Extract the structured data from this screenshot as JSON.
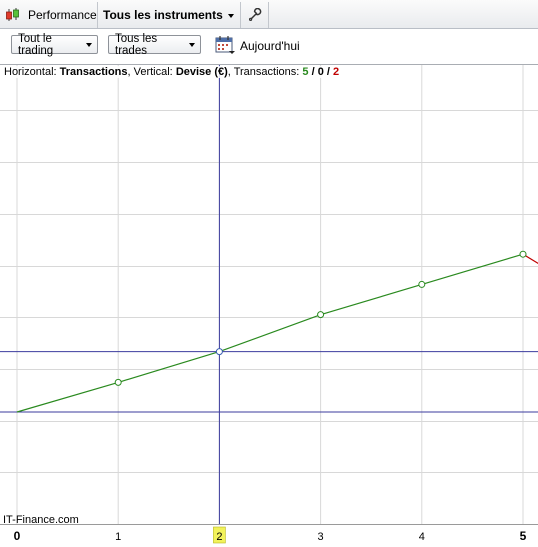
{
  "tabs": {
    "performance": "Performance",
    "instruments": "Tous les instruments"
  },
  "toolbar": {
    "filter_trading": "Tout le trading",
    "filter_trades": "Tous les trades",
    "today": "Aujourd'hui"
  },
  "header": {
    "horizontal_label": "Horizontal:",
    "horizontal_value": "Transactions",
    "vertical_label": ", Vertical:",
    "vertical_value": "Devise (€)",
    "transactions_label": ", Transactions:",
    "count_winning": "5",
    "count_neutral": "0",
    "count_losing": "2",
    "slash": "/"
  },
  "watermark": "IT-Finance.com",
  "colors": {
    "gain_line": "#2a8a1f",
    "loss_line": "#c00000",
    "crosshair": "#3b3b9e",
    "grid": "#d8d8d8",
    "highlight_tick": "#f2f25a"
  },
  "chart_data": {
    "type": "line",
    "x_ticks": [
      0,
      1,
      2,
      3,
      4,
      5
    ],
    "highlighted_x": 2,
    "xlim": [
      -0.15,
      5.15
    ],
    "ylim": [
      -20,
      62
    ],
    "series": [
      {
        "points": [
          [
            0,
            0
          ],
          [
            1,
            5.3
          ],
          [
            2,
            10.8
          ],
          [
            3,
            17.4
          ],
          [
            4,
            22.8
          ],
          [
            5,
            28.2
          ]
        ]
      },
      {
        "points": [
          [
            5,
            28.2
          ],
          [
            5.2,
            26.0
          ]
        ]
      }
    ],
    "crosshair": {
      "x": 2,
      "y": 10.8
    },
    "zero_line_y": 0,
    "markers_on": [
      1,
      2,
      3,
      4,
      5
    ]
  }
}
